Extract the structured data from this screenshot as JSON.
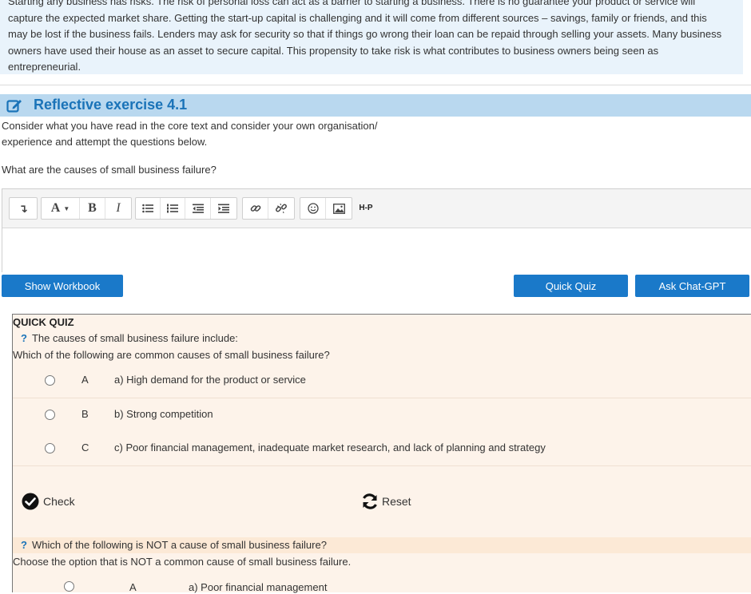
{
  "intro": {
    "lines": [
      "Starting any business has risks. The risk of personal loss can act as a barrier to starting a business. There is no guarantee your product or service will",
      "capture the expected market share. Getting the start-up capital is challenging and it will come from different sources – savings, family or friends, and this",
      "may be lost if the business fails. Lenders may ask for security so that if things go wrong their loan can be repaid through selling your assets. Many business",
      "owners have used their house as an asset to secure capital. This propensity to take risk is what contributes to business owners being seen as",
      "entrepreneurial."
    ]
  },
  "reflective": {
    "icon": "edit-icon",
    "title": "Reflective exercise 4.1",
    "instruction_line1": "Consider what you have read in the core text and consider your own organisation/",
    "instruction_line2": "experience and attempt the questions below.",
    "question": "What are the causes of small business failure?"
  },
  "editor": {
    "toolbar": {
      "paragraph_icon": "↴",
      "font_size_label": "A",
      "bold_label": "B",
      "italic_label": "I",
      "hp_label": "H-P"
    }
  },
  "buttons": {
    "show_workbook": "Show Workbook",
    "quick_quiz": "Quick Quiz",
    "ask_chatgpt": "Ask Chat-GPT"
  },
  "quiz": {
    "heading": "QUICK QUIZ",
    "question_mark": "?",
    "q1": {
      "title": "The causes of small business failure include:",
      "text": "Which of the following are common causes of small business failure?",
      "options": [
        {
          "letter": "A",
          "text": "a) High demand for the product or service"
        },
        {
          "letter": "B",
          "text": "b) Strong competition"
        },
        {
          "letter": "C",
          "text": "c) Poor financial management, inadequate market research, and lack of planning and strategy"
        }
      ]
    },
    "check_label": "Check",
    "reset_label": "Reset",
    "q2": {
      "title": "Which of the following is NOT a cause of small business failure?",
      "text": "Choose the option that is NOT a common cause of small business failure.",
      "options": [
        {
          "letter": "A",
          "text": "a) Poor financial management"
        }
      ]
    }
  },
  "colors": {
    "accent": "#1a79c9",
    "title_blue": "#1a73b8",
    "header_band": "#b9d8ef",
    "intro_bg": "#e9f3fb",
    "quiz_bg": "#fdf3ea"
  }
}
